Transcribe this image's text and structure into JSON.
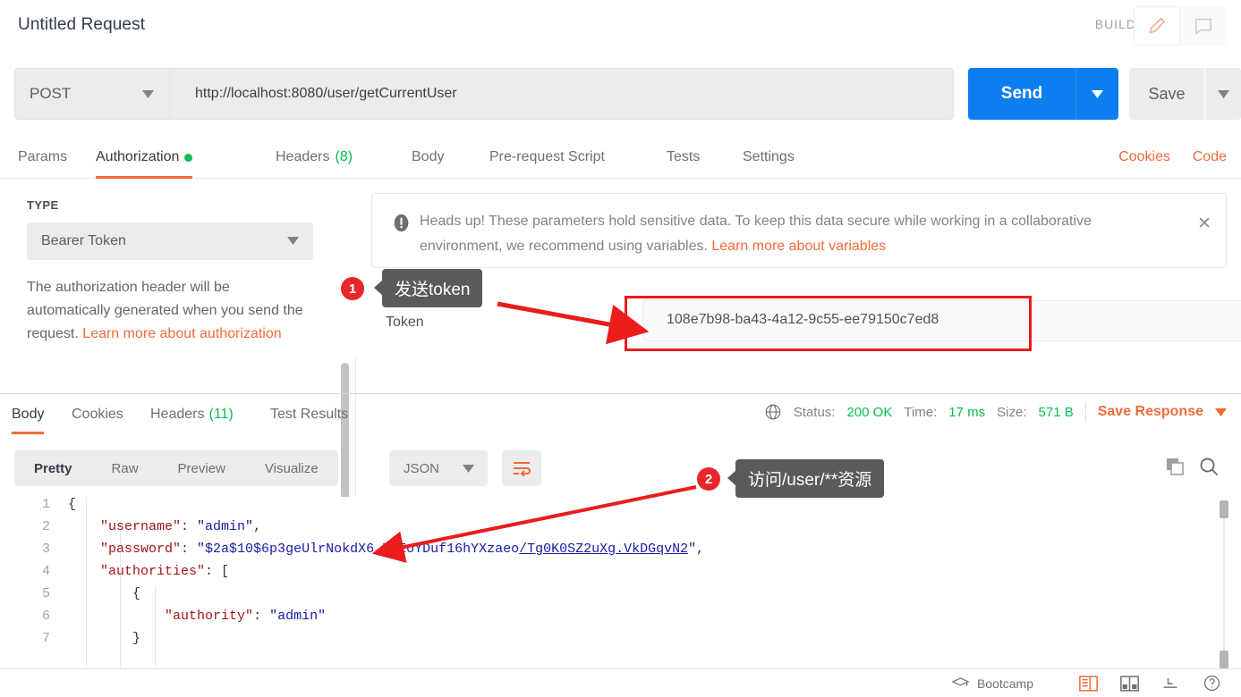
{
  "header": {
    "request_title": "Untitled Request",
    "build_label": "BUILD",
    "edit_icon": "pencil-icon",
    "comment_icon": "comment-icon"
  },
  "url_bar": {
    "method": "POST",
    "url": "http://localhost:8080/user/getCurrentUser",
    "send_label": "Send",
    "save_label": "Save"
  },
  "request_tabs": [
    {
      "label": "Params",
      "active": false,
      "badge": ""
    },
    {
      "label": "Authorization",
      "active": true,
      "badge": "dot"
    },
    {
      "label": "Headers",
      "active": false,
      "badge": "(8)"
    },
    {
      "label": "Body",
      "active": false,
      "badge": ""
    },
    {
      "label": "Pre-request Script",
      "active": false,
      "badge": ""
    },
    {
      "label": "Tests",
      "active": false,
      "badge": ""
    },
    {
      "label": "Settings",
      "active": false,
      "badge": ""
    }
  ],
  "request_tabs_right": [
    {
      "label": "Cookies"
    },
    {
      "label": "Code"
    }
  ],
  "auth": {
    "type_label": "TYPE",
    "type_value": "Bearer Token",
    "help_text": "The authorization header will be automatically generated when you send the request. ",
    "help_link": "Learn more about authorization",
    "token_label": "Token",
    "token_value": "108e7b98-ba43-4a12-9c55-ee79150c7ed8"
  },
  "heads_up": {
    "icon": "alert-icon",
    "text": "Heads up! These parameters hold sensitive data. To keep this data secure while working in a collaborative environment, we recommend using variables. ",
    "link": "Learn more about variables",
    "close": "✕"
  },
  "response_tabs": [
    {
      "label": "Body",
      "active": true,
      "badge": ""
    },
    {
      "label": "Cookies",
      "active": false,
      "badge": ""
    },
    {
      "label": "Headers",
      "active": false,
      "badge": "(11)"
    },
    {
      "label": "Test Results",
      "active": false,
      "badge": ""
    }
  ],
  "response_meta": {
    "globe_icon": "globe-icon",
    "status_label": "Status:",
    "status_value": "200 OK",
    "time_label": "Time:",
    "time_value": "17 ms",
    "size_label": "Size:",
    "size_value": "571 B",
    "save_response": "Save Response"
  },
  "format_bar": {
    "segments": [
      {
        "label": "Pretty",
        "active": true
      },
      {
        "label": "Raw",
        "active": false
      },
      {
        "label": "Preview",
        "active": false
      },
      {
        "label": "Visualize",
        "active": false
      }
    ],
    "language": "JSON",
    "wrap_icon": "word-wrap-icon",
    "copy_icon": "copy-icon",
    "search_icon": "search-icon"
  },
  "code": {
    "lines": [
      {
        "n": "1",
        "tokens": [
          {
            "t": "{",
            "c": "p"
          }
        ],
        "indent": 0
      },
      {
        "n": "2",
        "tokens": [
          {
            "t": "\"username\"",
            "c": "k"
          },
          {
            "t": ": ",
            "c": "p"
          },
          {
            "t": "\"admin\"",
            "c": "s"
          },
          {
            "t": ",",
            "c": "p"
          }
        ],
        "indent": 4
      },
      {
        "n": "3",
        "tokens": [
          {
            "t": "\"password\"",
            "c": "k"
          },
          {
            "t": ": ",
            "c": "p"
          },
          {
            "t": "\"$2a$10$6p3geUlrNokdX6.BUEoYDuf16hYXzaeo",
            "c": "s"
          },
          {
            "t": "/Tg0K0SZ2uXg.VkDGqvN2",
            "c": "s u"
          },
          {
            "t": "\"",
            "c": "s"
          },
          {
            "t": ",",
            "c": "p"
          }
        ],
        "indent": 4
      },
      {
        "n": "4",
        "tokens": [
          {
            "t": "\"authorities\"",
            "c": "k"
          },
          {
            "t": ": [",
            "c": "p"
          }
        ],
        "indent": 4
      },
      {
        "n": "5",
        "tokens": [
          {
            "t": "{",
            "c": "p"
          }
        ],
        "indent": 8
      },
      {
        "n": "6",
        "tokens": [
          {
            "t": "\"authority\"",
            "c": "k"
          },
          {
            "t": ": ",
            "c": "p"
          },
          {
            "t": "\"admin\"",
            "c": "s"
          }
        ],
        "indent": 12
      },
      {
        "n": "7",
        "tokens": [
          {
            "t": "}",
            "c": "p"
          }
        ],
        "indent": 8
      }
    ]
  },
  "bottom_bar": {
    "bootcamp_label": "Bootcamp",
    "bootcamp_icon": "graduation-cap-icon",
    "icons": [
      {
        "name": "two-pane-icon",
        "active": true
      },
      {
        "name": "split-pane-icon",
        "active": false
      },
      {
        "name": "trash-icon",
        "active": false
      },
      {
        "name": "help-icon",
        "active": false
      }
    ]
  },
  "annotations": [
    {
      "num": "1",
      "text": "发送token"
    },
    {
      "num": "2",
      "text": "访问/user/**资源"
    }
  ]
}
